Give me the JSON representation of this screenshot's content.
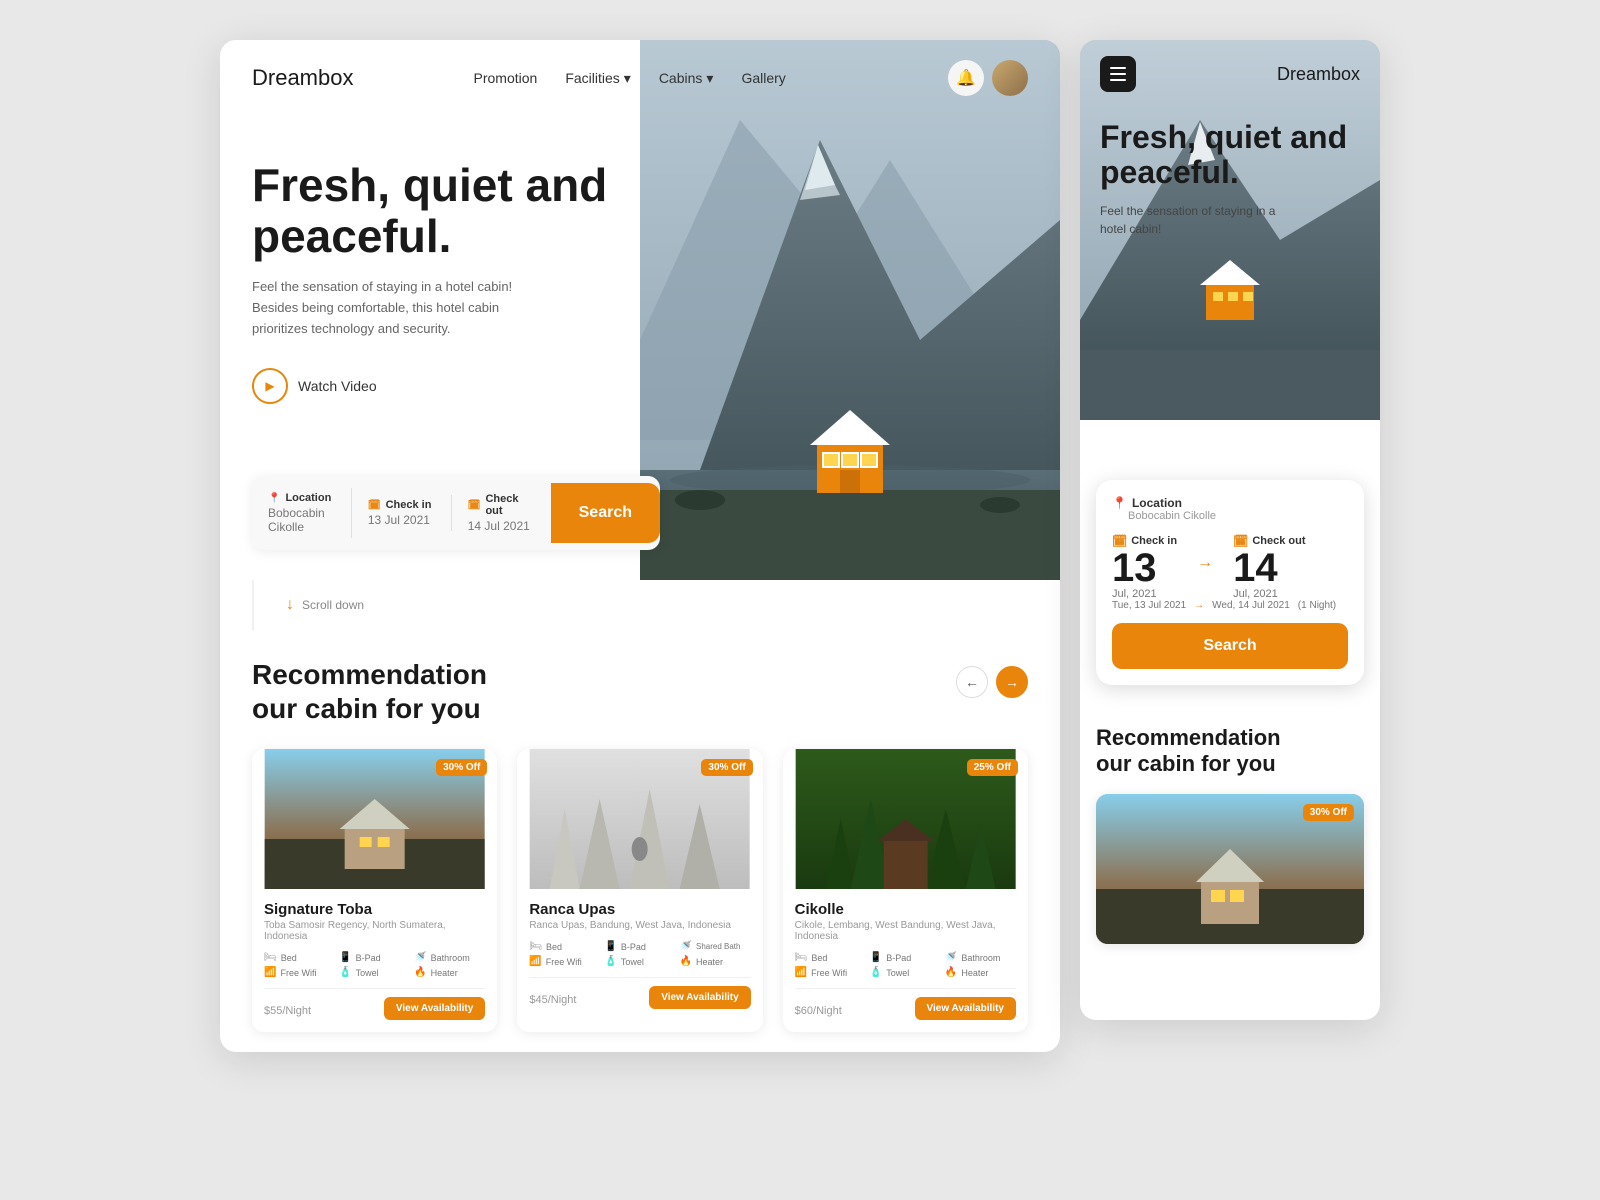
{
  "brand": {
    "name_bold": "Dream",
    "name_light": "box"
  },
  "nav": {
    "links": [
      {
        "label": "Promotion",
        "has_dropdown": false
      },
      {
        "label": "Facilities",
        "has_dropdown": true
      },
      {
        "label": "Cabins",
        "has_dropdown": true
      },
      {
        "label": "Gallery",
        "has_dropdown": false
      }
    ]
  },
  "hero": {
    "title": "Fresh, quiet and peaceful.",
    "description": "Feel the sensation of staying in a hotel cabin! Besides being comfortable, this hotel cabin prioritizes technology and security.",
    "watch_label": "Watch Video"
  },
  "search_bar": {
    "location_label": "Location",
    "location_value": "Bobocabin Cikolle",
    "checkin_label": "Check in",
    "checkin_value": "13 Jul 2021",
    "checkout_label": "Check out",
    "checkout_value": "14 Jul 2021",
    "button_label": "Search"
  },
  "scroll": {
    "label": "Scroll down"
  },
  "recommendations": {
    "title_line1": "Recommendation",
    "title_line2": "our cabin for you",
    "cabins": [
      {
        "name": "Signature Toba",
        "location": "Toba Samosir Regency, North Sumatera, Indonesia",
        "discount": "30% Off",
        "amenities": [
          "Bed",
          "B-Pad",
          "Bathroom",
          "Free Wifi",
          "Towel",
          "Heater"
        ],
        "price": "$55",
        "per": "/Night",
        "image_type": "toba",
        "view_label": "View Availability"
      },
      {
        "name": "Ranca Upas",
        "location": "Ranca Upas, Bandung, West Java, Indonesia",
        "discount": "30% Off",
        "amenities": [
          "Bed",
          "B-Pad",
          "Shared Bathroom",
          "Free Wifi",
          "Towel",
          "Heater"
        ],
        "price": "$45",
        "per": "/Night",
        "image_type": "ranca",
        "view_label": "View Availability"
      },
      {
        "name": "Cikolle",
        "location": "Cikole, Lembang, West Bandung, West Java, Indonesia",
        "discount": "25% Off",
        "amenities": [
          "Bed",
          "B-Pad",
          "Bathroom",
          "Free Wifi",
          "Towel",
          "Heater"
        ],
        "price": "$60",
        "per": "/Night",
        "image_type": "cikolle",
        "view_label": "View Availability"
      }
    ]
  },
  "mobile": {
    "hero_title": "Fresh, quiet and peaceful.",
    "hero_desc": "Feel the sensation of staying in a hotel cabin!",
    "location_label": "Location",
    "location_value": "Bobocabin Cikolle",
    "checkin_label": "Check in",
    "checkin_date": "13",
    "checkin_month": "Jul, 2021",
    "checkout_label": "Check out",
    "checkout_date": "14",
    "checkout_month": "Jul, 2021",
    "date_range_start": "Tue, 13 Jul 2021",
    "date_range_end": "Wed, 14 Jul 2021",
    "nights": "(1 Night)",
    "search_label": "Search",
    "rec_title_line1": "Recommendation",
    "rec_title_line2": "our cabin for you",
    "mobile_card_discount": "30% Off"
  }
}
